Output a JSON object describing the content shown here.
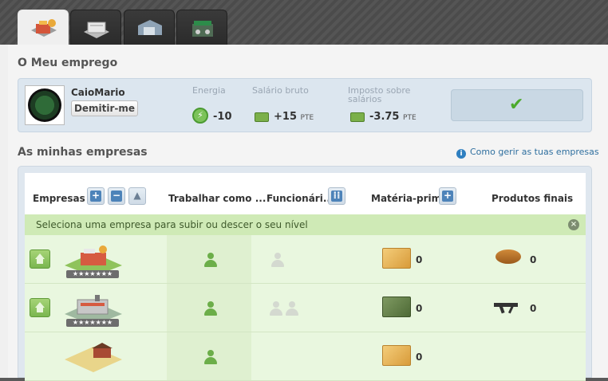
{
  "tabs": [
    {
      "name": "company-tab",
      "icon": "company-building-icon",
      "active": true
    },
    {
      "name": "warehouse-tab",
      "icon": "warehouse-icon",
      "active": false
    },
    {
      "name": "storage-tab",
      "icon": "storage-building-icon",
      "active": false
    },
    {
      "name": "market-tab",
      "icon": "market-icon",
      "active": false
    }
  ],
  "my_job": {
    "title": "O Meu emprego",
    "username": "CaioMario",
    "quit_label": "Demitir-me",
    "energy_label": "Energia",
    "energy_value": "-10",
    "salary_label": "Salário bruto",
    "salary_value": "+15",
    "salary_unit": "PTE",
    "tax_label_1": "Imposto sobre",
    "tax_label_2": "salários",
    "tax_value": "-3.75",
    "tax_unit": "PTE"
  },
  "companies": {
    "title": "As minhas empresas",
    "help_link": "Como gerir as tuas empresas",
    "headers": {
      "companies": "Empresas",
      "work_as": "Trabalhar como ...",
      "employees": "Funcionári...",
      "raw_material": "Matéria-prima",
      "final_products": "Produtos finais"
    },
    "notice": "Seleciona uma empresa para subir ou descer o seu nível",
    "rows": [
      {
        "has_upgrade": true,
        "stars": "★★★★★★★",
        "employees_shown": 1,
        "raw_qty": "0",
        "raw_icon": "raw-material-crate-icon",
        "final_qty": "0",
        "final_icon": "bread-icon"
      },
      {
        "has_upgrade": true,
        "stars": "★★★★★★★",
        "employees_shown": 2,
        "raw_qty": "0",
        "raw_icon": "weapon-raw-material-crate-icon",
        "final_qty": "0",
        "final_icon": "weapon-icon"
      },
      {
        "has_upgrade": false,
        "stars": "",
        "employees_shown": 0,
        "raw_qty": "0",
        "raw_icon": "raw-material-crate-icon",
        "final_qty": "",
        "final_icon": ""
      }
    ]
  }
}
